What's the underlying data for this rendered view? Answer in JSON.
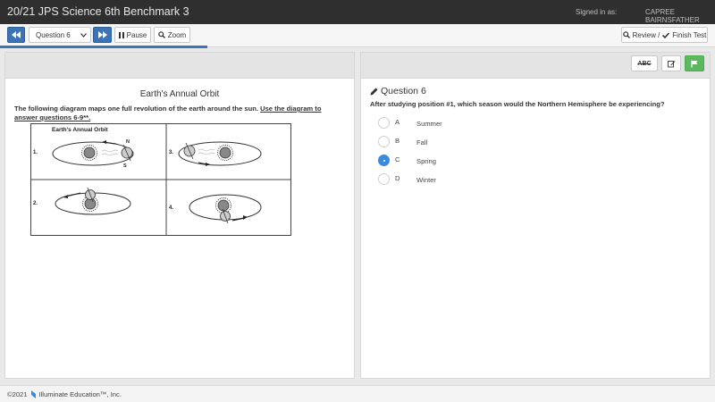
{
  "header": {
    "title": "20/21 JPS Science 6th Benchmark 3",
    "signed_in_label": "Signed in as:",
    "user_name": "CAPREE BAIRNSFATHER"
  },
  "toolbar": {
    "question_select_value": "Question 6",
    "pause_label": "Pause",
    "zoom_label": "Zoom",
    "review_label": "Review /",
    "finish_label": "Finish Test",
    "progress_fraction": 0.29
  },
  "passage": {
    "title": "Earth's Annual Orbit",
    "text_plain": "The following diagram maps one full revolution of the earth around the sun.",
    "text_underlined": "Use the diagram to answer questions 6-9**.",
    "diagram": {
      "title": "Earth's Annual Orbit",
      "positions": [
        "1.",
        "3.",
        "2.",
        "4."
      ],
      "north_label": "N",
      "south_label": "S"
    }
  },
  "question": {
    "number_label": "Question 6",
    "text": "After studying position #1, which season would the Northern Hemisphere be experiencing?",
    "tools": {
      "abc_label": "ABC"
    },
    "choices": [
      {
        "letter": "A",
        "text": "Summer",
        "selected": false
      },
      {
        "letter": "B",
        "text": "Fall",
        "selected": false
      },
      {
        "letter": "C",
        "text": "Spring",
        "selected": true
      },
      {
        "letter": "D",
        "text": "Winter",
        "selected": false
      }
    ]
  },
  "footer": {
    "copyright": "©2021",
    "company": "Illuminate Education™, Inc."
  },
  "colors": {
    "accent_blue": "#3a73b6",
    "flag_green": "#5cb85c",
    "topbar": "#2f2f2f"
  }
}
